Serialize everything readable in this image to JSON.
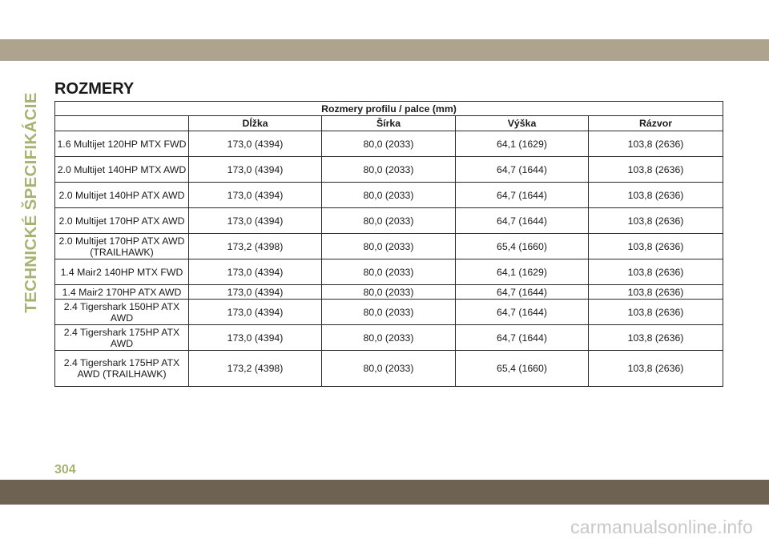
{
  "side_tab": "TECHNICKÉ ŠPECIFIKÁCIE",
  "section_title": "ROZMERY",
  "table": {
    "caption": "Rozmery profilu / palce (mm)",
    "headers": [
      "",
      "Dĺžka",
      "Šírka",
      "Výška",
      "Rázvor"
    ],
    "rows": [
      [
        "1.6 Multijet 120HP MTX FWD",
        "173,0 (4394)",
        "80,0 (2033)",
        "64,1 (1629)",
        "103,8 (2636)"
      ],
      [
        "2.0 Multijet 140HP MTX AWD",
        "173,0 (4394)",
        "80,0 (2033)",
        "64,7 (1644)",
        "103,8 (2636)"
      ],
      [
        "2.0 Multijet 140HP ATX AWD",
        "173,0 (4394)",
        "80,0 (2033)",
        "64,7 (1644)",
        "103,8 (2636)"
      ],
      [
        "2.0 Multijet 170HP ATX AWD",
        "173,0 (4394)",
        "80,0 (2033)",
        "64,7 (1644)",
        "103,8 (2636)"
      ],
      [
        "2.0 Multijet 170HP ATX AWD (TRAILHAWK)",
        "173,2 (4398)",
        "80,0 (2033)",
        "65,4 (1660)",
        "103,8 (2636)"
      ],
      [
        "1.4 Mair2 140HP MTX FWD",
        "173,0 (4394)",
        "80,0 (2033)",
        "64,1 (1629)",
        "103,8 (2636)"
      ],
      [
        "1.4 Mair2 170HP ATX AWD",
        "173,0 (4394)",
        "80,0 (2033)",
        "64,7 (1644)",
        "103,8 (2636)"
      ],
      [
        "2.4 Tigershark 150HP ATX AWD",
        "173,0 (4394)",
        "80,0 (2033)",
        "64,7 (1644)",
        "103,8 (2636)"
      ],
      [
        "2.4 Tigershark 175HP ATX AWD",
        "173,0 (4394)",
        "80,0 (2033)",
        "64,7 (1644)",
        "103,8 (2636)"
      ],
      [
        "2.4 Tigershark 175HP ATX AWD (TRAILHAWK)",
        "173,2 (4398)",
        "80,0 (2033)",
        "65,4 (1660)",
        "103,8 (2636)"
      ]
    ]
  },
  "page_number": "304",
  "watermark": "carmanualsonline.info",
  "colors": {
    "top_band": "#aea38d",
    "bottom_band": "#6e6352",
    "accent_green": "#a8b272"
  }
}
